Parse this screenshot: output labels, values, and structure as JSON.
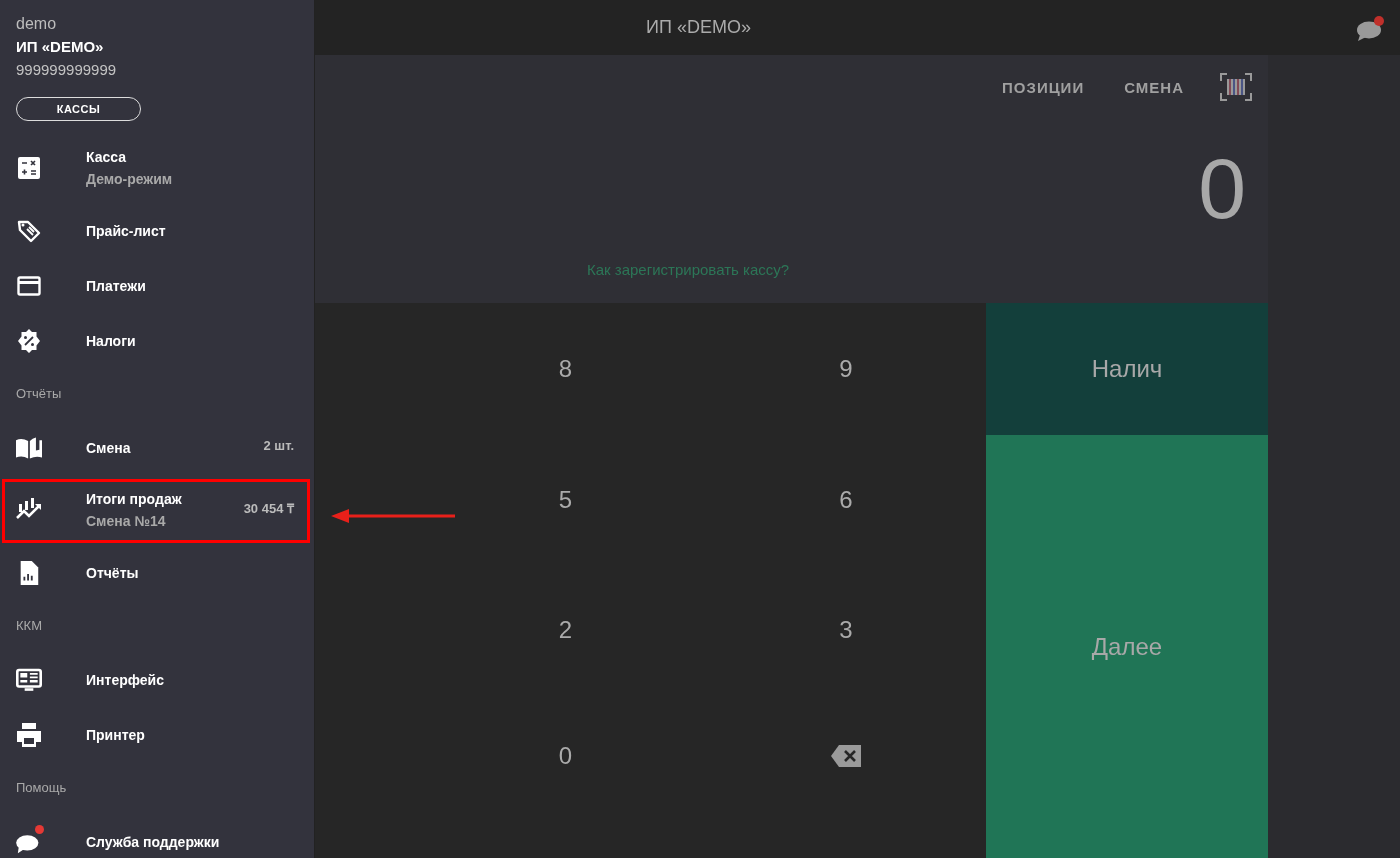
{
  "sidebar": {
    "login": "demo",
    "company": "ИП «DEMO»",
    "tax_id": "999999999999",
    "registers_button": "КАССЫ",
    "items": [
      {
        "kind": "item",
        "label": "Касса",
        "subtitle": "Демо-режим"
      },
      {
        "kind": "item",
        "label": "Прайс-лист"
      },
      {
        "kind": "item",
        "label": "Платежи"
      },
      {
        "kind": "item",
        "label": "Налоги"
      },
      {
        "kind": "header",
        "label": "Отчёты"
      },
      {
        "kind": "item",
        "label": "Смена",
        "value": "2 шт."
      },
      {
        "kind": "item",
        "label": "Итоги продаж",
        "subtitle": "Смена №14",
        "value": "30 454 ₸",
        "highlighted": true
      },
      {
        "kind": "item",
        "label": "Отчёты"
      },
      {
        "kind": "header",
        "label": "ККМ"
      },
      {
        "kind": "item",
        "label": "Интерфейс"
      },
      {
        "kind": "item",
        "label": "Принтер"
      },
      {
        "kind": "header",
        "label": "Помощь"
      },
      {
        "kind": "item",
        "label": "Служба поддержки",
        "notification": true
      }
    ]
  },
  "top_bar": {
    "title": "ИП «DEMO»",
    "chat_notification": true
  },
  "toolbar": {
    "tabs": [
      "ПОЗИЦИИ",
      "СМЕНА"
    ]
  },
  "amount": "0",
  "register_link": "Как зарегистрировать кассу?",
  "keypad": [
    {
      "kind": "digit",
      "label": "8"
    },
    {
      "kind": "digit",
      "label": "9"
    },
    {
      "kind": "digit",
      "label": "5"
    },
    {
      "kind": "digit",
      "label": "6"
    },
    {
      "kind": "digit",
      "label": "2"
    },
    {
      "kind": "digit",
      "label": "3"
    },
    {
      "kind": "digit",
      "label": "0"
    },
    {
      "kind": "backspace"
    }
  ],
  "payment_buttons": [
    {
      "kind": "cash",
      "label": "Налич"
    },
    {
      "kind": "next",
      "label": "Далее"
    }
  ]
}
